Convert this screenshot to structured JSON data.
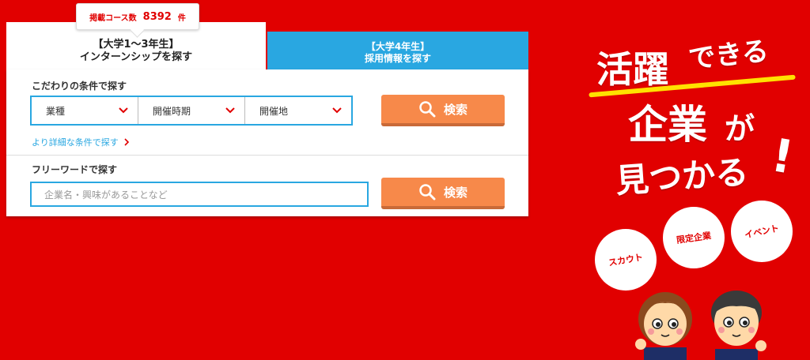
{
  "count_badge": {
    "label": "掲載コース数",
    "number": "8392",
    "unit": "件"
  },
  "tabs": [
    {
      "line1": "【大学1～3年生】",
      "line2": "インターンシップを探す"
    },
    {
      "line1": "【大学4年生】",
      "line2": "採用情報を探す"
    }
  ],
  "conditions": {
    "title": "こだわりの条件で探す",
    "selects": [
      "業種",
      "開催時期",
      "開催地"
    ],
    "search_label": "検索",
    "more_link": "より詳細な条件で探す"
  },
  "freeword": {
    "title": "フリーワードで探す",
    "placeholder": "企業名・興味があることなど",
    "search_label": "検索"
  },
  "promo": {
    "line1a": "活躍",
    "line1b": "できる",
    "line2a": "企業",
    "line2b": "が",
    "line3a": "見つかる",
    "line3b": "!",
    "badges": [
      "スカウト",
      "限定企業",
      "イベント"
    ]
  },
  "colors": {
    "background": "#e10000",
    "accent_blue": "#29a7e1",
    "button_orange": "#f7894a",
    "highlight_yellow": "#ffe100"
  }
}
